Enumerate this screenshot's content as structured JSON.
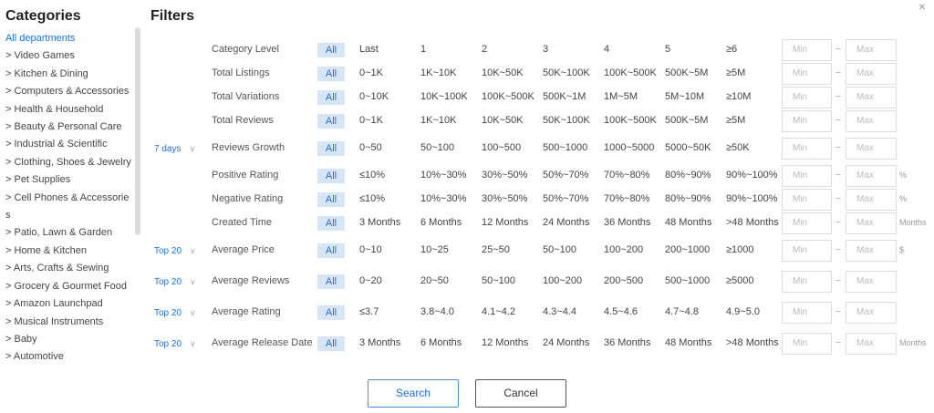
{
  "dialog": {
    "close_glyph": "×"
  },
  "categories": {
    "title": "Categories",
    "items": [
      "All departments",
      "> Video Games",
      "> Kitchen & Dining",
      "> Computers & Accessories",
      "> Health & Household",
      "> Beauty & Personal Care",
      "> Industrial & Scientific",
      "> Clothing, Shoes & Jewelry",
      "> Pet Supplies",
      "> Cell Phones & Accessorie",
      "s",
      "> Patio, Lawn & Garden",
      "> Home & Kitchen",
      "> Arts, Crafts & Sewing",
      "> Grocery & Gourmet Food",
      "> Amazon Launchpad",
      "> Musical Instruments",
      "> Baby",
      "> Automotive"
    ]
  },
  "filters": {
    "title": "Filters",
    "min_placeholder": "Min",
    "max_placeholder": "Max",
    "range_sep": "~",
    "rows": [
      {
        "period": "",
        "label": "Category Level",
        "options": [
          "All",
          "Last",
          "1",
          "2",
          "3",
          "4",
          "5",
          "≥6"
        ],
        "unit": ""
      },
      {
        "period": "",
        "label": "Total Listings",
        "options": [
          "All",
          "0~1K",
          "1K~10K",
          "10K~50K",
          "50K~100K",
          "100K~500K",
          "500K~5M",
          "≥5M"
        ],
        "unit": ""
      },
      {
        "period": "",
        "label": "Total Variations",
        "options": [
          "All",
          "0~10K",
          "10K~100K",
          "100K~500K",
          "500K~1M",
          "1M~5M",
          "5M~10M",
          "≥10M"
        ],
        "unit": ""
      },
      {
        "period": "",
        "label": "Total Reviews",
        "options": [
          "All",
          "0~1K",
          "1K~10K",
          "10K~50K",
          "50K~100K",
          "100K~500K",
          "500K~5M",
          "≥5M"
        ],
        "unit": ""
      },
      {
        "period": "7 days",
        "label": "Reviews Growth",
        "options": [
          "All",
          "0~50",
          "50~100",
          "100~500",
          "500~1000",
          "1000~5000",
          "5000~50K",
          "≥50K"
        ],
        "unit": ""
      },
      {
        "period": "",
        "label": "Positive Rating",
        "options": [
          "All",
          "≤10%",
          "10%~30%",
          "30%~50%",
          "50%~70%",
          "70%~80%",
          "80%~90%",
          "90%~100%"
        ],
        "unit": "%"
      },
      {
        "period": "",
        "label": "Negative Rating",
        "options": [
          "All",
          "≤10%",
          "10%~30%",
          "30%~50%",
          "50%~70%",
          "70%~80%",
          "80%~90%",
          "90%~100%"
        ],
        "unit": "%"
      },
      {
        "period": "",
        "label": "Created Time",
        "options": [
          "All",
          "3 Months",
          "6 Months",
          "12 Months",
          "24 Months",
          "36 Months",
          "48 Months",
          ">48 Months"
        ],
        "unit": "Months"
      },
      {
        "period": "Top 20",
        "label": "Average Price",
        "options": [
          "All",
          "0~10",
          "10~25",
          "25~50",
          "50~100",
          "100~200",
          "200~1000",
          "≥1000"
        ],
        "unit": "$"
      },
      {
        "period": "Top 20",
        "label": "Average Reviews",
        "options": [
          "All",
          "0~20",
          "20~50",
          "50~100",
          "100~200",
          "200~500",
          "500~1000",
          "≥5000"
        ],
        "unit": ""
      },
      {
        "period": "Top 20",
        "label": "Average Rating",
        "options": [
          "All",
          "≤3.7",
          "3.8~4.0",
          "4.1~4.2",
          "4.3~4.4",
          "4.5~4.6",
          "4.7~4.8",
          "4.9~5.0"
        ],
        "unit": ""
      },
      {
        "period": "Top 20",
        "label": "Average Release Date",
        "options": [
          "All",
          "3 Months",
          "6 Months",
          "12 Months",
          "24 Months",
          "36 Months",
          "48 Months",
          ">48 Months"
        ],
        "unit": "Months"
      }
    ]
  },
  "buttons": {
    "search_label": "Search",
    "cancel_label": "Cancel"
  },
  "colors": {
    "accent": "#1e6fd9",
    "all_chip_bg": "#d7e6f7"
  }
}
